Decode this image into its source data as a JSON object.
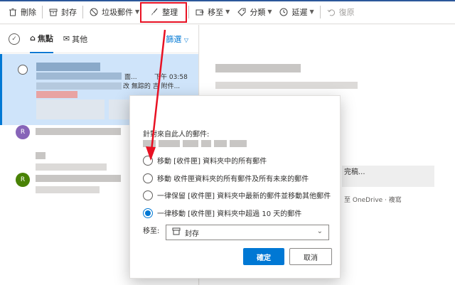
{
  "toolbar": {
    "items": [
      {
        "icon": "trash-icon",
        "glyph": "🗑",
        "label": "刪除"
      },
      {
        "icon": "archive-icon",
        "glyph": "▭",
        "label": "封存"
      },
      {
        "icon": "junk-icon",
        "glyph": "⊘",
        "label": "垃圾郵件"
      },
      {
        "icon": "sweep-icon",
        "glyph": "✎",
        "label": "整理"
      },
      {
        "icon": "move-icon",
        "glyph": "⎘",
        "label": "移至"
      },
      {
        "icon": "tag-icon",
        "glyph": "◇",
        "label": "分類"
      },
      {
        "icon": "clock-icon",
        "glyph": "◷",
        "label": "延遲"
      },
      {
        "icon": "undo-icon",
        "glyph": "↶",
        "label": "復原"
      }
    ]
  },
  "tabs": {
    "focused": "焦點",
    "other": "其他",
    "filter": "篩選"
  },
  "list": {
    "row1_snippet_a": "面...",
    "row1_time": "下午 03:58",
    "row1_snippet_b": "改 無踪的 吉 附件..."
  },
  "reading": {
    "link_text": "完稿...",
    "onedrive": "至 OneDrive · 複寫"
  },
  "dialog": {
    "sender_label": "針對來自此人的郵件:",
    "options": [
      "移動 [收件匣] 資料夾中的所有郵件",
      "移動 收件匣資料夾的所有郵件及所有未來的郵件",
      "一律保留 [收件匣] 資料夾中最新的郵件並移動其他郵件",
      "一律移動 [收件匣] 資料夾中超過 10 天的郵件"
    ],
    "selected_index": 3,
    "move_label": "移至:",
    "move_value": "封存",
    "ok": "確定",
    "cancel": "取消"
  },
  "colors": {
    "accent": "#0078d4",
    "highlight": "#e81123",
    "avatar_purple": "#8764b8",
    "avatar_green": "#498205"
  }
}
